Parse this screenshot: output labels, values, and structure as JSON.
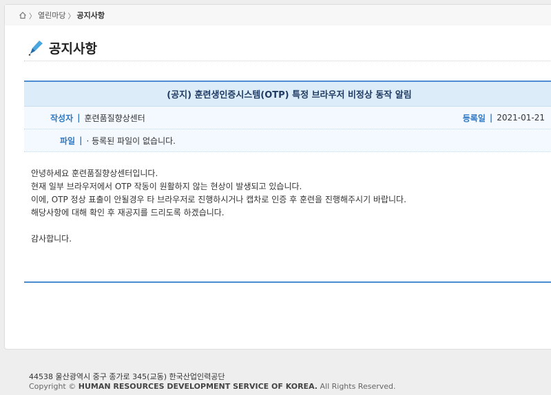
{
  "breadcrumb": {
    "items": [
      "열린마당",
      "공지사항"
    ]
  },
  "page": {
    "title": "공지사항"
  },
  "post": {
    "title": "(공지) 훈련생인증시스템(OTP) 특정 브라우저 비정상 동작 알림",
    "author_label": "작성자",
    "author": "훈련품질향상센터",
    "date_label": "등록일",
    "date": "2021-01-21",
    "file_label": "파일",
    "file_value": "· 등록된 파일이 없습니다.",
    "body": [
      "안녕하세요 훈련품질향상센터입니다.",
      "현재 일부 브라우저에서 OTP 작동이 원활하지 않는 현상이 발생되고 있습니다.",
      "이에, OTP 정상 표출이 안될경우 타 브라우저로 진행하시거나 캡차로 인증 후 훈련을 진행해주시기 바랍니다.",
      "해당사항에 대해 확인 후 재공지를 드리도록 하겠습니다.",
      "",
      "감사합니다."
    ]
  },
  "footer": {
    "address": "44538 울산광역시 중구 종가로 345(교동) 한국산업인력공단",
    "copyright_prefix": "Copyright ©",
    "organization": "HUMAN RESOURCES DEVELOPMENT SERVICE OF KOREA.",
    "copyright_suffix": "All Rights Reserved."
  },
  "colors": {
    "accent": "#4a8bd1",
    "label": "#2d78c3",
    "title_bg": "#dcedf9"
  }
}
